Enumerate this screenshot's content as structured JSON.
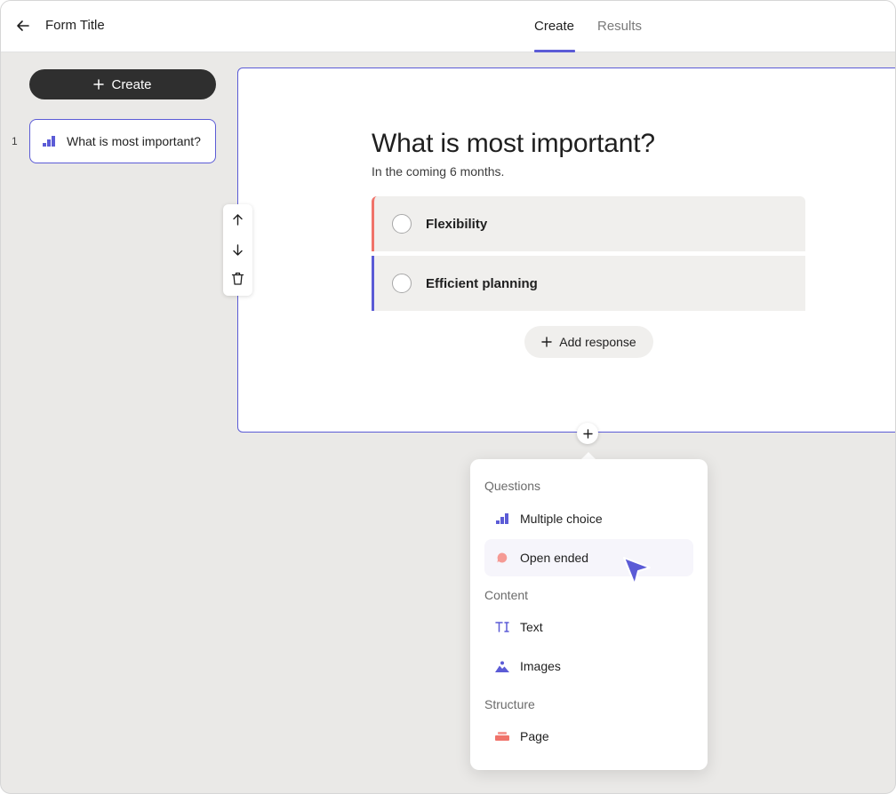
{
  "header": {
    "back_icon": "arrow-left-icon",
    "title": "Form Title",
    "tabs": [
      {
        "label": "Create",
        "active": true
      },
      {
        "label": "Results",
        "active": false
      }
    ]
  },
  "sidebar": {
    "create_label": "Create",
    "slides": [
      {
        "number": "1",
        "icon": "multiple-choice-icon",
        "label": "What is most important?"
      }
    ]
  },
  "question": {
    "title": "What is most important?",
    "subtitle": "In the coming 6 months.",
    "options": [
      {
        "label": "Flexibility",
        "color": "#f0736a"
      },
      {
        "label": "Efficient planning",
        "color": "#5b5bd6"
      }
    ],
    "add_response_label": "Add response"
  },
  "toolbar": {
    "icons": [
      "arrow-up-icon",
      "arrow-down-icon",
      "trash-icon"
    ]
  },
  "menu": {
    "sections": [
      {
        "label": "Questions",
        "items": [
          {
            "label": "Multiple choice",
            "icon": "multiple-choice-icon"
          },
          {
            "label": "Open ended",
            "icon": "speech-bubble-icon",
            "hovered": true
          }
        ]
      },
      {
        "label": "Content",
        "items": [
          {
            "label": "Text",
            "icon": "text-icon"
          },
          {
            "label": "Images",
            "icon": "image-icon"
          }
        ]
      },
      {
        "label": "Structure",
        "items": [
          {
            "label": "Page",
            "icon": "page-icon"
          }
        ]
      }
    ]
  },
  "colors": {
    "accent": "#5b5bd6",
    "coral": "#f0736a",
    "dark_button": "#2f2f2f",
    "background": "#eae9e7"
  }
}
